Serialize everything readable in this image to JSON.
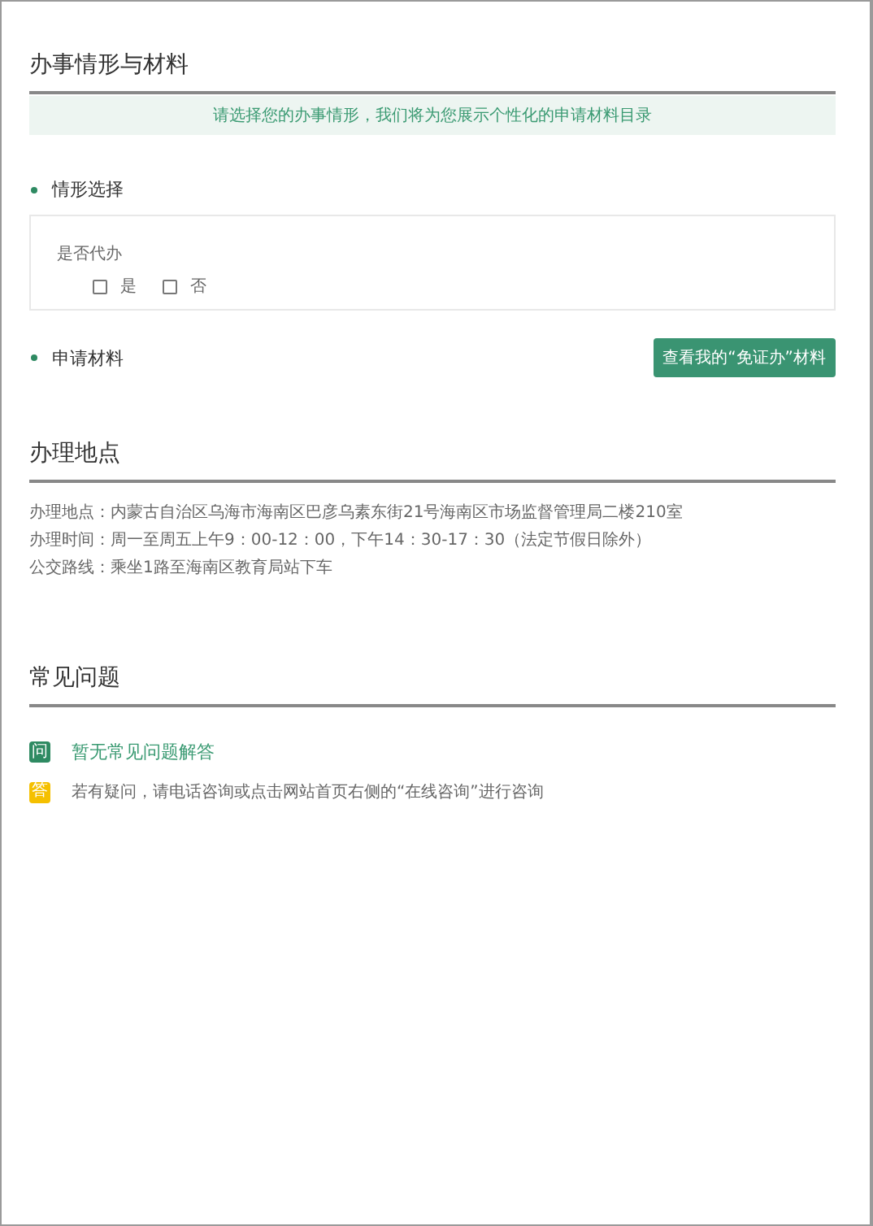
{
  "materials": {
    "title": "办事情形与材料",
    "notice": "请选择您的办事情形，我们将为您展示个性化的申请材料目录",
    "situation": {
      "heading": "情形选择",
      "question": "是否代办",
      "options": [
        {
          "label": "是",
          "checked": false
        },
        {
          "label": "否",
          "checked": false
        }
      ]
    },
    "application": {
      "heading": "申请材料",
      "button": "查看我的“免证办”材料"
    }
  },
  "location": {
    "title": "办理地点",
    "lines": [
      "办理地点：内蒙古自治区乌海市海南区巴彦乌素东街21号海南区市场监督管理局二楼210室",
      "办理时间：周一至周五上午9：00-12：00，下午14：30-17：30（法定节假日除外）",
      "公交路线：乘坐1路至海南区教育局站下车"
    ]
  },
  "faq": {
    "title": "常见问题",
    "items": [
      {
        "kind": "question",
        "badge": "问",
        "text": "暂无常见问题解答"
      },
      {
        "kind": "answer",
        "badge": "答",
        "text": "若有疑问，请电话咨询或点击网站首页右侧的“在线咨询”进行咨询"
      }
    ]
  }
}
